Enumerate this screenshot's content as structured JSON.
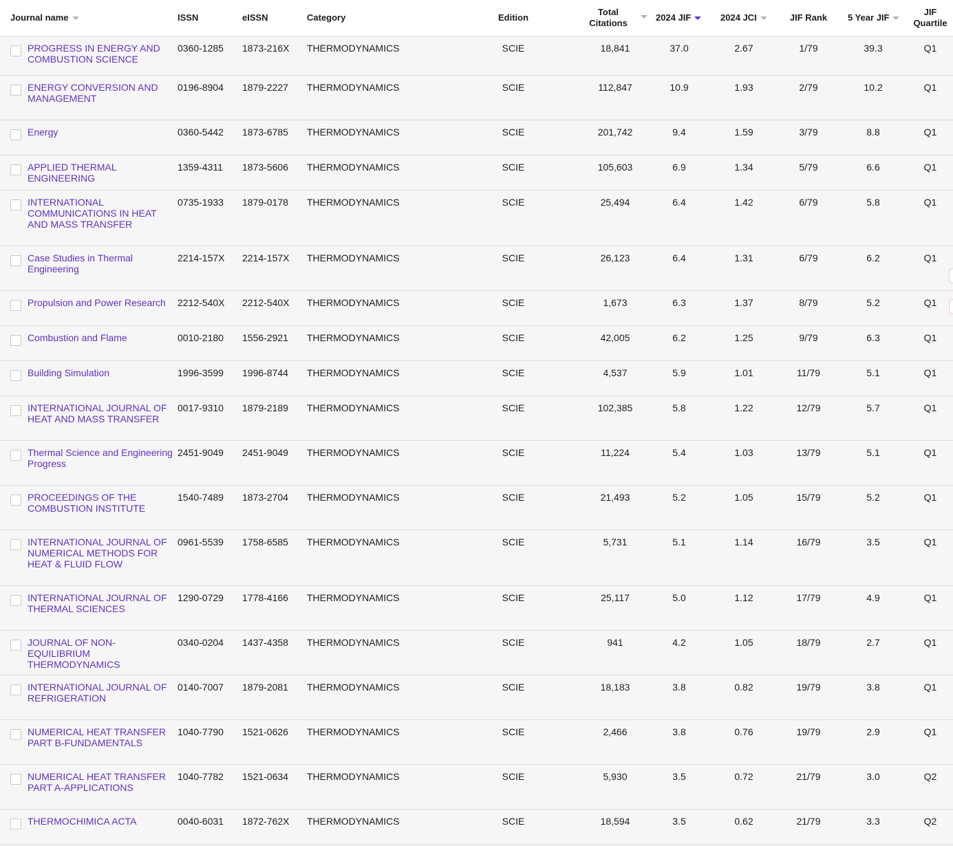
{
  "header": {
    "journal_name": "Journal name",
    "issn": "ISSN",
    "eissn": "eISSN",
    "category": "Category",
    "edition": "Edition",
    "total_citations_line1": "Total",
    "total_citations_line2": "Citations",
    "jif": "2024 JIF",
    "jci": "2024 JCI",
    "jif_rank": "JIF Rank",
    "five_year_jif": "5 Year JIF",
    "quartile_line1": "JIF",
    "quartile_line2": "Quartile"
  },
  "rows": [
    {
      "name": "PROGRESS IN ENERGY AND COMBUSTION SCIENCE",
      "issn": "0360-1285",
      "eissn": "1873-216X",
      "category": "THERMODYNAMICS",
      "edition": "SCIE",
      "citations": "18,841",
      "jif": "37.0",
      "jci": "2.67",
      "rank": "1/79",
      "five_year": "39.3",
      "quartile": "Q1"
    },
    {
      "name": "ENERGY CONVERSION AND MANAGEMENT",
      "issn": "0196-8904",
      "eissn": "1879-2227",
      "category": "THERMODYNAMICS",
      "edition": "SCIE",
      "citations": "112,847",
      "jif": "10.9",
      "jci": "1.93",
      "rank": "2/79",
      "five_year": "10.2",
      "quartile": "Q1"
    },
    {
      "name": "Energy",
      "issn": "0360-5442",
      "eissn": "1873-6785",
      "category": "THERMODYNAMICS",
      "edition": "SCIE",
      "citations": "201,742",
      "jif": "9.4",
      "jci": "1.59",
      "rank": "3/79",
      "five_year": "8.8",
      "quartile": "Q1"
    },
    {
      "name": "APPLIED THERMAL ENGINEERING",
      "issn": "1359-4311",
      "eissn": "1873-5606",
      "category": "THERMODYNAMICS",
      "edition": "SCIE",
      "citations": "105,603",
      "jif": "6.9",
      "jci": "1.34",
      "rank": "5/79",
      "five_year": "6.6",
      "quartile": "Q1"
    },
    {
      "name": "INTERNATIONAL COMMUNICATIONS IN HEAT AND MASS TRANSFER",
      "issn": "0735-1933",
      "eissn": "1879-0178",
      "category": "THERMODYNAMICS",
      "edition": "SCIE",
      "citations": "25,494",
      "jif": "6.4",
      "jci": "1.42",
      "rank": "6/79",
      "five_year": "5.8",
      "quartile": "Q1"
    },
    {
      "name": "Case Studies in Thermal Engineering",
      "issn": "2214-157X",
      "eissn": "2214-157X",
      "category": "THERMODYNAMICS",
      "edition": "SCIE",
      "citations": "26,123",
      "jif": "6.4",
      "jci": "1.31",
      "rank": "6/79",
      "five_year": "6.2",
      "quartile": "Q1"
    },
    {
      "name": "Propulsion and Power Research",
      "issn": "2212-540X",
      "eissn": "2212-540X",
      "category": "THERMODYNAMICS",
      "edition": "SCIE",
      "citations": "1,673",
      "jif": "6.3",
      "jci": "1.37",
      "rank": "8/79",
      "five_year": "5.2",
      "quartile": "Q1"
    },
    {
      "name": "Combustion and Flame",
      "issn": "0010-2180",
      "eissn": "1556-2921",
      "category": "THERMODYNAMICS",
      "edition": "SCIE",
      "citations": "42,005",
      "jif": "6.2",
      "jci": "1.25",
      "rank": "9/79",
      "five_year": "6.3",
      "quartile": "Q1"
    },
    {
      "name": "Building Simulation",
      "issn": "1996-3599",
      "eissn": "1996-8744",
      "category": "THERMODYNAMICS",
      "edition": "SCIE",
      "citations": "4,537",
      "jif": "5.9",
      "jci": "1.01",
      "rank": "11/79",
      "five_year": "5.1",
      "quartile": "Q1"
    },
    {
      "name": "INTERNATIONAL JOURNAL OF HEAT AND MASS TRANSFER",
      "issn": "0017-9310",
      "eissn": "1879-2189",
      "category": "THERMODYNAMICS",
      "edition": "SCIE",
      "citations": "102,385",
      "jif": "5.8",
      "jci": "1.22",
      "rank": "12/79",
      "five_year": "5.7",
      "quartile": "Q1"
    },
    {
      "name": "Thermal Science and Engineering Progress",
      "issn": "2451-9049",
      "eissn": "2451-9049",
      "category": "THERMODYNAMICS",
      "edition": "SCIE",
      "citations": "11,224",
      "jif": "5.4",
      "jci": "1.03",
      "rank": "13/79",
      "five_year": "5.1",
      "quartile": "Q1"
    },
    {
      "name": "PROCEEDINGS OF THE COMBUSTION INSTITUTE",
      "issn": "1540-7489",
      "eissn": "1873-2704",
      "category": "THERMODYNAMICS",
      "edition": "SCIE",
      "citations": "21,493",
      "jif": "5.2",
      "jci": "1.05",
      "rank": "15/79",
      "five_year": "5.2",
      "quartile": "Q1"
    },
    {
      "name": "INTERNATIONAL JOURNAL OF NUMERICAL METHODS FOR HEAT & FLUID FLOW",
      "issn": "0961-5539",
      "eissn": "1758-6585",
      "category": "THERMODYNAMICS",
      "edition": "SCIE",
      "citations": "5,731",
      "jif": "5.1",
      "jci": "1.14",
      "rank": "16/79",
      "five_year": "3.5",
      "quartile": "Q1"
    },
    {
      "name": "INTERNATIONAL JOURNAL OF THERMAL SCIENCES",
      "issn": "1290-0729",
      "eissn": "1778-4166",
      "category": "THERMODYNAMICS",
      "edition": "SCIE",
      "citations": "25,117",
      "jif": "5.0",
      "jci": "1.12",
      "rank": "17/79",
      "five_year": "4.9",
      "quartile": "Q1"
    },
    {
      "name": "JOURNAL OF NON-EQUILIBRIUM THERMODYNAMICS",
      "issn": "0340-0204",
      "eissn": "1437-4358",
      "category": "THERMODYNAMICS",
      "edition": "SCIE",
      "citations": "941",
      "jif": "4.2",
      "jci": "1.05",
      "rank": "18/79",
      "five_year": "2.7",
      "quartile": "Q1"
    },
    {
      "name": "INTERNATIONAL JOURNAL OF REFRIGERATION",
      "issn": "0140-7007",
      "eissn": "1879-2081",
      "category": "THERMODYNAMICS",
      "edition": "SCIE",
      "citations": "18,183",
      "jif": "3.8",
      "jci": "0.82",
      "rank": "19/79",
      "five_year": "3.8",
      "quartile": "Q1"
    },
    {
      "name": "NUMERICAL HEAT TRANSFER PART B-FUNDAMENTALS",
      "issn": "1040-7790",
      "eissn": "1521-0626",
      "category": "THERMODYNAMICS",
      "edition": "SCIE",
      "citations": "2,466",
      "jif": "3.8",
      "jci": "0.76",
      "rank": "19/79",
      "five_year": "2.9",
      "quartile": "Q1"
    },
    {
      "name": "NUMERICAL HEAT TRANSFER PART A-APPLICATIONS",
      "issn": "1040-7782",
      "eissn": "1521-0634",
      "category": "THERMODYNAMICS",
      "edition": "SCIE",
      "citations": "5,930",
      "jif": "3.5",
      "jci": "0.72",
      "rank": "21/79",
      "five_year": "3.0",
      "quartile": "Q2"
    },
    {
      "name": "THERMOCHIMICA ACTA",
      "issn": "0040-6031",
      "eissn": "1872-762X",
      "category": "THERMODYNAMICS",
      "edition": "SCIE",
      "citations": "18,594",
      "jif": "3.5",
      "jci": "0.62",
      "rank": "21/79",
      "five_year": "3.3",
      "quartile": "Q2"
    }
  ],
  "colors": {
    "link": "#5e33bf",
    "sort_active": "#5e33bf",
    "sort_inactive": "#b4b4b4",
    "row_bg": "#f6f6f6",
    "header_bg": "#ffffff",
    "border": "#dcdcdc"
  }
}
